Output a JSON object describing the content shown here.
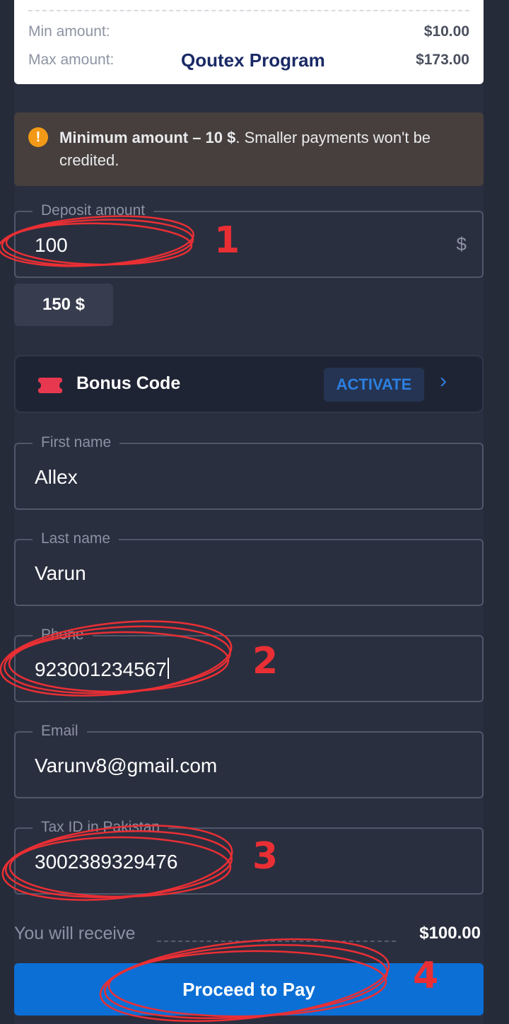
{
  "limits": {
    "min_label": "Min amount:",
    "min_value": "$10.00",
    "max_label": "Max amount:",
    "max_value": "$173.00",
    "overlay_title": "Qoutex Program"
  },
  "warning": {
    "icon": "exclamation-icon",
    "bold": "Minimum amount – 10 $",
    "rest": ". Smaller payments won't be credited."
  },
  "deposit": {
    "label": "Deposit amount",
    "value": "100",
    "currency": "$"
  },
  "quick_amount": "150 $",
  "bonus": {
    "icon": "ticket-icon",
    "label": "Bonus Code",
    "action": "ACTIVATE",
    "chevron": "›"
  },
  "first_name": {
    "label": "First name",
    "value": "Allex"
  },
  "last_name": {
    "label": "Last name",
    "value": "Varun"
  },
  "phone": {
    "label": "Phone",
    "value": "923001234567"
  },
  "email": {
    "label": "Email",
    "value": "Varunv8@gmail.com"
  },
  "tax_id": {
    "label": "Tax ID in Pakistan",
    "value": "3002389329476"
  },
  "receive": {
    "label": "You will receive",
    "value": "$100.00"
  },
  "pay_button": "Proceed to Pay",
  "annotations": [
    "1",
    "2",
    "3",
    "4"
  ],
  "colors": {
    "accent": "#0b6fd6",
    "annotation": "#ea2f34",
    "warning": "#f29a17",
    "ticket": "#e8384f"
  }
}
